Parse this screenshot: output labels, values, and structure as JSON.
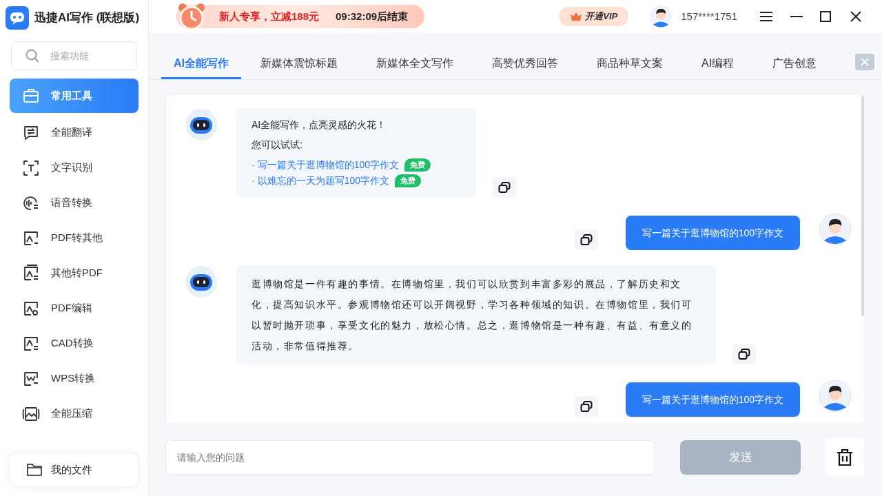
{
  "app": {
    "title": "迅捷AI写作 (联想版)"
  },
  "promo": {
    "text": "新人专享，立减188元",
    "countdown": "09:32:09后结束"
  },
  "vip_button": "开通VIP",
  "user": {
    "phone": "157****1751"
  },
  "search": {
    "placeholder": "搜索功能"
  },
  "sidebar": {
    "items": [
      {
        "label": "常用工具",
        "selected": true
      },
      {
        "label": "全能翻译",
        "selected": false
      },
      {
        "label": "文字识别",
        "selected": false
      },
      {
        "label": "语音转换",
        "selected": false
      },
      {
        "label": "PDF转其他",
        "selected": false
      },
      {
        "label": "其他转PDF",
        "selected": false
      },
      {
        "label": "PDF编辑",
        "selected": false
      },
      {
        "label": "CAD转换",
        "selected": false
      },
      {
        "label": "WPS转换",
        "selected": false
      },
      {
        "label": "全能压缩",
        "selected": false
      }
    ],
    "footer": "我的文件"
  },
  "tabs": [
    {
      "label": "AI全能写作",
      "selected": true
    },
    {
      "label": "新媒体震惊标题",
      "selected": false
    },
    {
      "label": "新媒体全文写作",
      "selected": false
    },
    {
      "label": "高赞优秀回答",
      "selected": false
    },
    {
      "label": "商品种草文案",
      "selected": false
    },
    {
      "label": "AI编程",
      "selected": false
    },
    {
      "label": "广告创意",
      "selected": false
    }
  ],
  "messages": [
    {
      "kind": "intro",
      "title": "AI全能写作，点亮灵感的火花！",
      "prompt": "您可以试试:",
      "suggestions": [
        {
          "marker": "·",
          "text": "写一篇关于逛博物馆的100字作文",
          "badge": "免费"
        },
        {
          "marker": "·",
          "text": "以难忘的一天为题写100字作文",
          "badge": "免费"
        }
      ]
    },
    {
      "kind": "user",
      "text": "写一篇关于逛博物馆的100字作文"
    },
    {
      "kind": "bot",
      "text": "逛博物馆是一件有趣的事情。在博物馆里，我们可以欣赏到丰富多彩的展品，了解历史和文化，提高知识水平。参观博物馆还可以开阔视野，学习各种领域的知识。在博物馆里，我们可以暂时抛开琐事，享受文化的魅力，放松心情。总之，逛博物馆是一种有趣、有益、有意义的活动，非常值得推荐。"
    },
    {
      "kind": "user",
      "text": "写一篇关于逛博物馆的100字作文"
    }
  ],
  "composer": {
    "placeholder": "请输入您的问题",
    "send": {
      "label": "发送",
      "disabled": true
    }
  }
}
